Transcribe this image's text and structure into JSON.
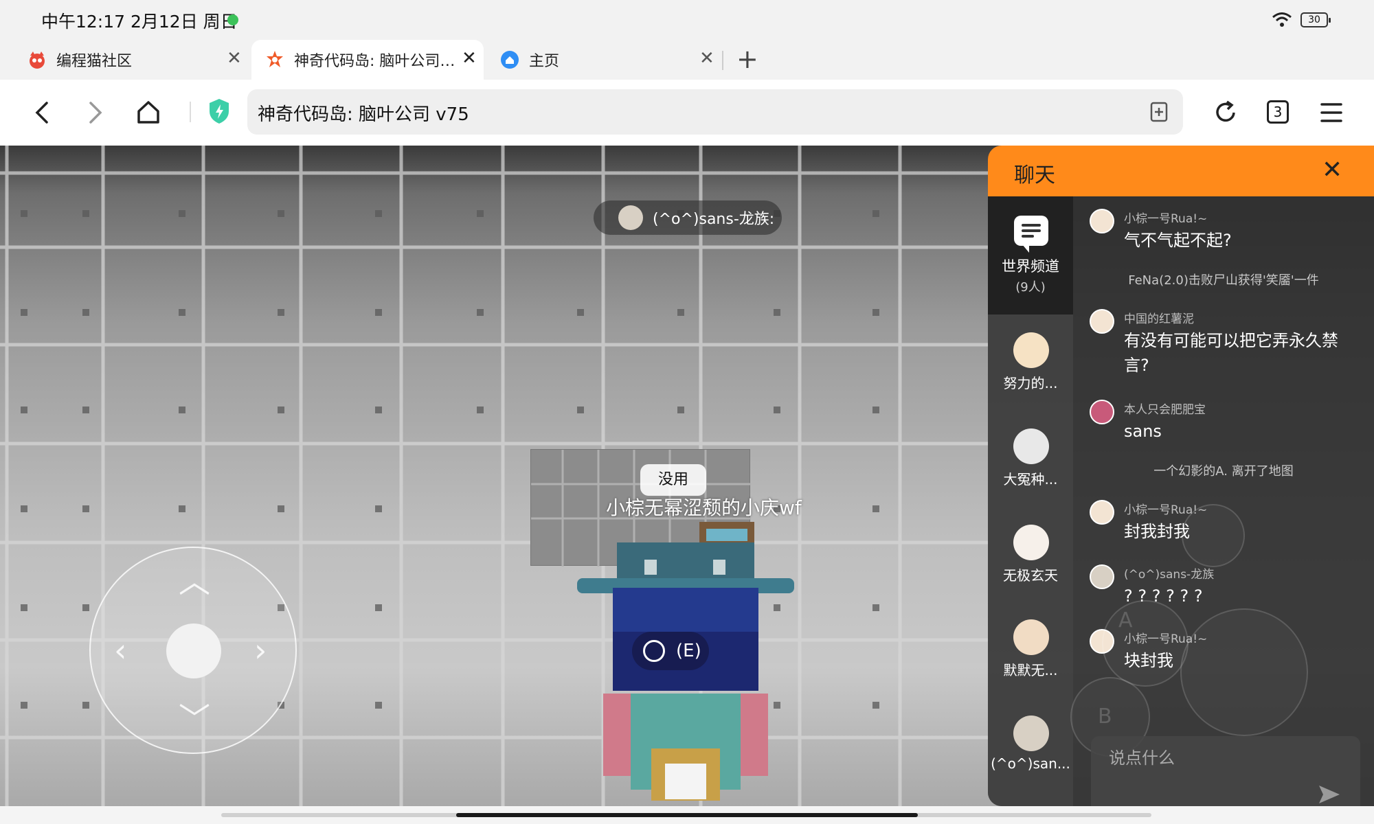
{
  "status_bar": {
    "time": "中午12:17  2月12日  周日",
    "battery": "30"
  },
  "tabs": [
    {
      "label": "编程猫社区",
      "close": "✕"
    },
    {
      "label": "神奇代码岛: 脑叶公司 …",
      "close": "✕"
    },
    {
      "label": "主页",
      "close": "✕"
    }
  ],
  "new_tab": "+",
  "toolbar": {
    "url": "神奇代码岛: 脑叶公司 v75",
    "tab_count": "3"
  },
  "game": {
    "player_tag": "(^o^)sans-龙族:",
    "use_label": "没用",
    "overlay_names": "小棕无",
    "overlay_names_mid": "幂涩颓",
    "overlay_names_end": "的小庆wf",
    "interact_key": "(E)"
  },
  "chat": {
    "title": "聊天",
    "close": "✕",
    "channel": {
      "name": "世界频道",
      "count": "(9人)"
    },
    "players": [
      {
        "name": "努力的..."
      },
      {
        "name": "大冤种..."
      },
      {
        "name": "无极玄天"
      },
      {
        "name": "默默无..."
      },
      {
        "name": "(^o^)san..."
      }
    ],
    "messages": [
      {
        "user": "小棕一号Rua!~",
        "text": "气不气起不起?"
      },
      {
        "system": "FeNa(2.0)击败尸山获得'笑靥'一件"
      },
      {
        "user": "中国的红薯泥",
        "text": "有没有可能可以把它弄永久禁言?"
      },
      {
        "user": "本人只会肥肥宝",
        "text": "sans"
      },
      {
        "system": "一个幻影的A. 离开了地图"
      },
      {
        "user": "小棕一号Rua!~",
        "text": "封我封我"
      },
      {
        "user": "(^o^)sans-龙族",
        "text": "? ? ? ? ? ?"
      },
      {
        "user": "小棕一号Rua!~",
        "text": "块封我"
      }
    ],
    "input_placeholder": "说点什么",
    "ghost_a": "A",
    "ghost_b": "B"
  },
  "colors": {
    "chat_header": "#ff8a1a",
    "status_dot": "#3cc25a"
  }
}
